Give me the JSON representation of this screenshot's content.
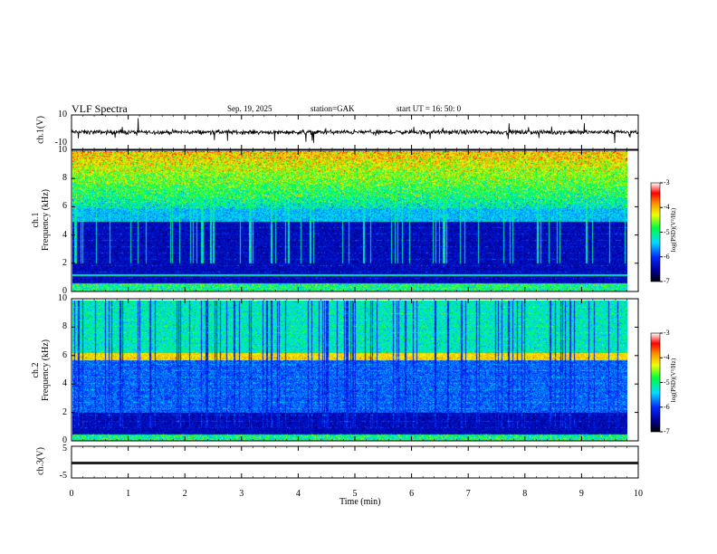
{
  "header": {
    "title": "VLF  Spectra",
    "date": "Sep. 19, 2025",
    "station": "station=GAK",
    "start": "start  UT =   16: 50: 0"
  },
  "chart_data": [
    {
      "type": "line",
      "ylabel": "ch.1(V)",
      "ylim": [
        -10,
        10
      ],
      "yticks": [
        "10",
        "-10"
      ],
      "xlim": [
        0,
        10
      ]
    },
    {
      "type": "heatmap",
      "ylabel": "ch.1\nFrequency (kHz)",
      "ylabel_lines": [
        "ch.1",
        "Frequency  (kHz)"
      ],
      "ylim": [
        0,
        10
      ],
      "yticks": [
        "0",
        "2",
        "4",
        "6",
        "8",
        "10"
      ],
      "xlim": [
        0,
        10
      ],
      "colorbar": {
        "label": "log(PSD)(V²/Hz)",
        "range": [
          -7,
          -3
        ],
        "ticks": [
          "-3",
          "-4",
          "-5",
          "-6",
          "-7"
        ]
      }
    },
    {
      "type": "heatmap",
      "ylabel_lines": [
        "ch.2",
        "Frequency  (kHz)"
      ],
      "ylim": [
        0,
        10
      ],
      "yticks": [
        "0",
        "2",
        "4",
        "6",
        "8",
        "10"
      ],
      "xlim": [
        0,
        10
      ],
      "colorbar": {
        "label": "log(PSD)(V²/Hz)",
        "range": [
          -7,
          -3
        ],
        "ticks": [
          "-3",
          "-4",
          "-5",
          "-6",
          "-7"
        ]
      }
    },
    {
      "type": "line",
      "ylabel": "ch.3(V)",
      "ylim": [
        -5,
        5
      ],
      "yticks": [
        "5",
        "-5"
      ],
      "xlim": [
        0,
        10
      ],
      "xlabel": "Time  (min)",
      "xticks": [
        "0",
        "1",
        "2",
        "3",
        "4",
        "5",
        "6",
        "7",
        "8",
        "9",
        "10"
      ]
    }
  ],
  "colors": {
    "trace": "#000000",
    "colormap": [
      "#000000",
      "#0000a0",
      "#0030ff",
      "#00e0ff",
      "#00ff40",
      "#f0ff00",
      "#ff9000",
      "#ff0000",
      "#ffffff"
    ]
  }
}
